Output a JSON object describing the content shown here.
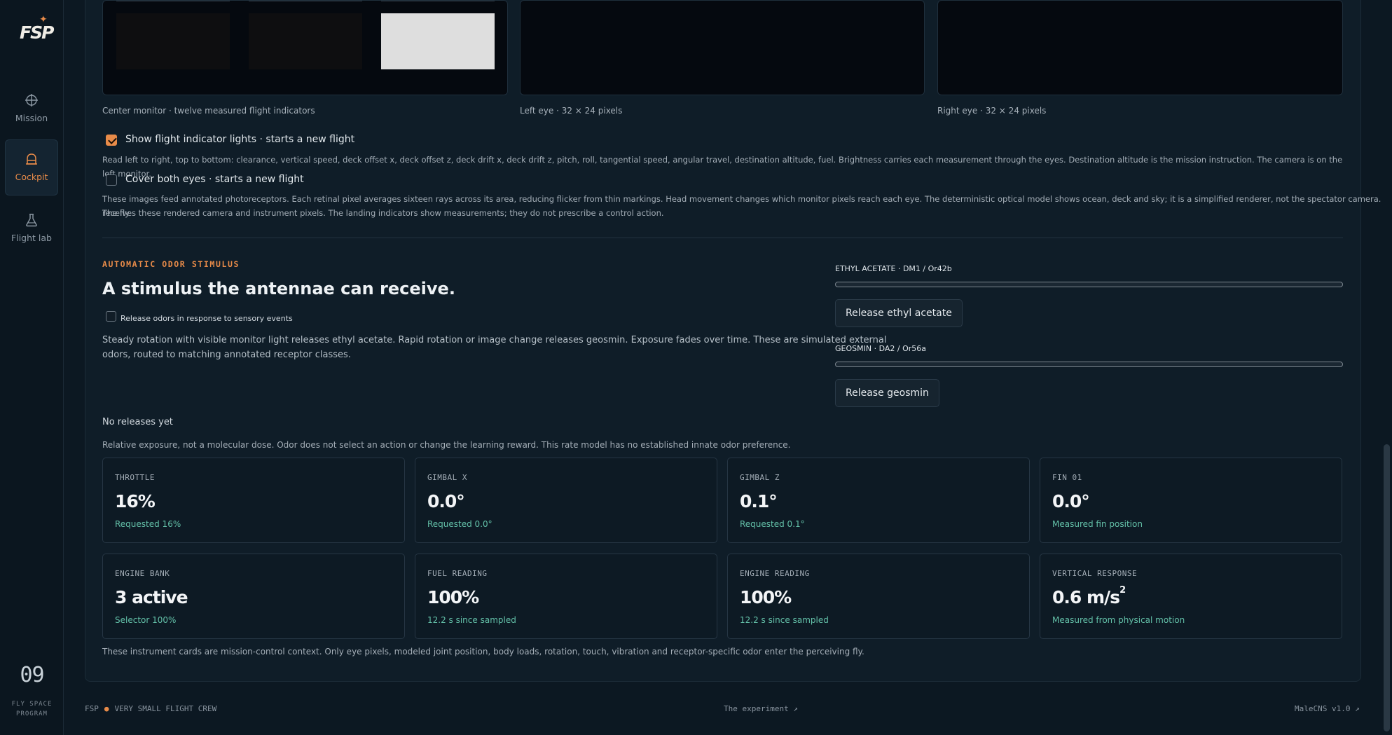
{
  "brand": {
    "logo_text": "FSP"
  },
  "nav": [
    {
      "label": "Mission",
      "icon": "crosshair-icon"
    },
    {
      "label": "Cockpit",
      "icon": "cockpit-icon",
      "active": true
    },
    {
      "label": "Flight lab",
      "icon": "flask-icon"
    }
  ],
  "sidebar": {
    "counter": "09",
    "program_line1": "FLY SPACE",
    "program_line2": "PROGRAM"
  },
  "monitors": {
    "center_caption": "Center monitor · twelve measured flight indicators",
    "left_caption": "Left eye · 32 × 24 pixels",
    "right_caption": "Right eye · 32 × 24 pixels"
  },
  "indicator_toggle": {
    "label": "Show flight indicator lights · starts a new flight",
    "checked": true,
    "note": "Read left to right, top to bottom: clearance, vertical speed, deck offset x, deck offset z, deck drift x, deck drift z, pitch, roll, tangential speed, angular travel, destination altitude, fuel. Brightness carries each measurement through the eyes. Destination altitude is the mission instruction. The camera is on the left monitor."
  },
  "cover_toggle": {
    "label": "Cover both eyes · starts a new flight",
    "checked": false,
    "note_line1": "These images feed annotated photoreceptors. Each retinal pixel averages sixteen rays across its area, reducing flicker from thin markings. Head movement changes which monitor pixels reach each eye. The deterministic optical model shows ocean, deck and sky; it is a simplified renderer, not the spectator camera. The fly",
    "note_line2": "receives these rendered camera and instrument pixels. The landing indicators show measurements; they do not prescribe a control action."
  },
  "odor": {
    "kicker": "AUTOMATIC ODOR STIMULUS",
    "headline": "A stimulus the antennae can receive.",
    "auto_label": "Release odors in response to sensory events",
    "auto_checked": false,
    "description_line1": "Steady rotation with visible monitor light releases ethyl acetate. Rapid rotation or image change releases geosmin. Exposure fades over time. These are simulated external",
    "description_line2": "odors, routed to matching annotated receptor classes.",
    "ethyl_label": "ETHYL ACETATE · DM1 / Or42b",
    "ethyl_level": 0,
    "ethyl_button": "Release ethyl acetate",
    "geosmin_label": "GEOSMIN · DA2 / Or56a",
    "geosmin_level": 0,
    "geosmin_button": "Release geosmin",
    "status": "No releases yet",
    "disclaimer": "Relative exposure, not a molecular dose. Odor does not select an action or change the learning reward. This rate model has no established innate odor preference."
  },
  "cards": [
    {
      "key": "THROTTLE",
      "value": "16%",
      "sub": "Requested 16%"
    },
    {
      "key": "GIMBAL X",
      "value": "0.0°",
      "sub": "Requested 0.0°"
    },
    {
      "key": "GIMBAL Z",
      "value": "0.1°",
      "sub": "Requested 0.1°"
    },
    {
      "key": "FIN 01",
      "value": "0.0°",
      "sub": "Measured fin position"
    },
    {
      "key": "ENGINE BANK",
      "value": "3 active",
      "sub": "Selector 100%"
    },
    {
      "key": "FUEL READING",
      "value": "100%",
      "sub": "12.2 s since sampled"
    },
    {
      "key": "ENGINE READING",
      "value": "100%",
      "sub": "12.2 s since sampled"
    },
    {
      "key": "VERTICAL RESPONSE",
      "value": "0.6 m/s",
      "value_sup": "2",
      "sub": "Measured from physical motion"
    }
  ],
  "cards_note": "These instrument cards are mission-control context. Only eye pixels, modeled joint position, body loads, rotation, touch, vibration and receptor-specific odor enter the perceiving fly.",
  "footer": {
    "left_a": "FSP",
    "left_b": "VERY SMALL FLIGHT CREW",
    "center": "The experiment ↗",
    "right": "MaleCNS v1.0 ↗"
  },
  "colors": {
    "accent": "#e88b49",
    "positive": "#63c0a8",
    "background": "#0c1822"
  }
}
